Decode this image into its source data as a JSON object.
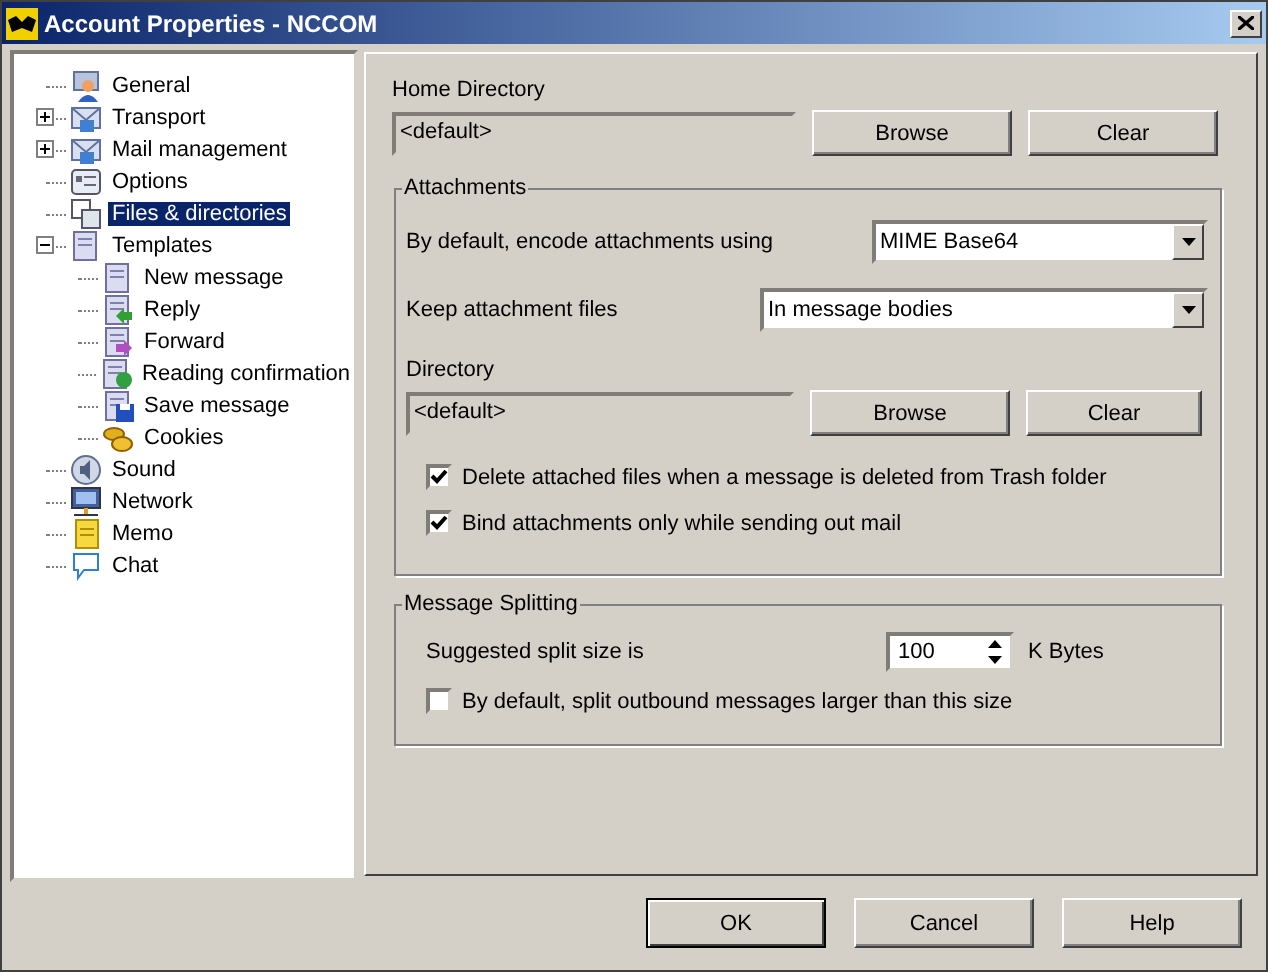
{
  "window": {
    "title": "Account Properties - NCCOM"
  },
  "tree": {
    "items": [
      {
        "label": "General",
        "selected": false
      },
      {
        "label": "Transport",
        "selected": false,
        "expanded": false
      },
      {
        "label": "Mail management",
        "selected": false,
        "expanded": false
      },
      {
        "label": "Options",
        "selected": false
      },
      {
        "label": "Files & directories",
        "selected": true
      },
      {
        "label": "Templates",
        "selected": false,
        "expanded": true,
        "children": [
          {
            "label": "New message",
            "selected": false
          },
          {
            "label": "Reply",
            "selected": false
          },
          {
            "label": "Forward",
            "selected": false
          },
          {
            "label": "Reading confirmation",
            "selected": false
          },
          {
            "label": "Save message",
            "selected": false
          },
          {
            "label": "Cookies",
            "selected": false
          }
        ]
      },
      {
        "label": "Sound",
        "selected": false
      },
      {
        "label": "Network",
        "selected": false
      },
      {
        "label": "Memo",
        "selected": false
      },
      {
        "label": "Chat",
        "selected": false
      }
    ]
  },
  "home_directory": {
    "label": "Home Directory",
    "value": "<default>",
    "disabled": true,
    "buttons": [
      "Browse",
      "Clear"
    ]
  },
  "attachments": {
    "title": "Attachments",
    "encoding": {
      "label": "By default, encode attachments using",
      "value": "MIME Base64"
    },
    "keep": {
      "label": "Keep attachment files",
      "value": "In message bodies"
    },
    "directory": {
      "label": "Directory",
      "value": "<default>",
      "disabled": true,
      "buttons": [
        "Browse",
        "Clear"
      ]
    },
    "options": [
      {
        "label": "Delete attached files when a message is deleted from Trash folder",
        "checked": true
      },
      {
        "label": "Bind attachments only while sending out mail",
        "checked": true
      }
    ]
  },
  "splitting": {
    "title": "Message Splitting",
    "size_label": "Suggested split size is",
    "size_value": "100",
    "unit": "K Bytes",
    "option": {
      "label": "By default, split outbound messages larger than this size",
      "checked": false
    }
  },
  "buttons": [
    {
      "label": "OK",
      "default": true
    },
    {
      "label": "Cancel",
      "default": false
    },
    {
      "label": "Help",
      "default": false
    }
  ]
}
